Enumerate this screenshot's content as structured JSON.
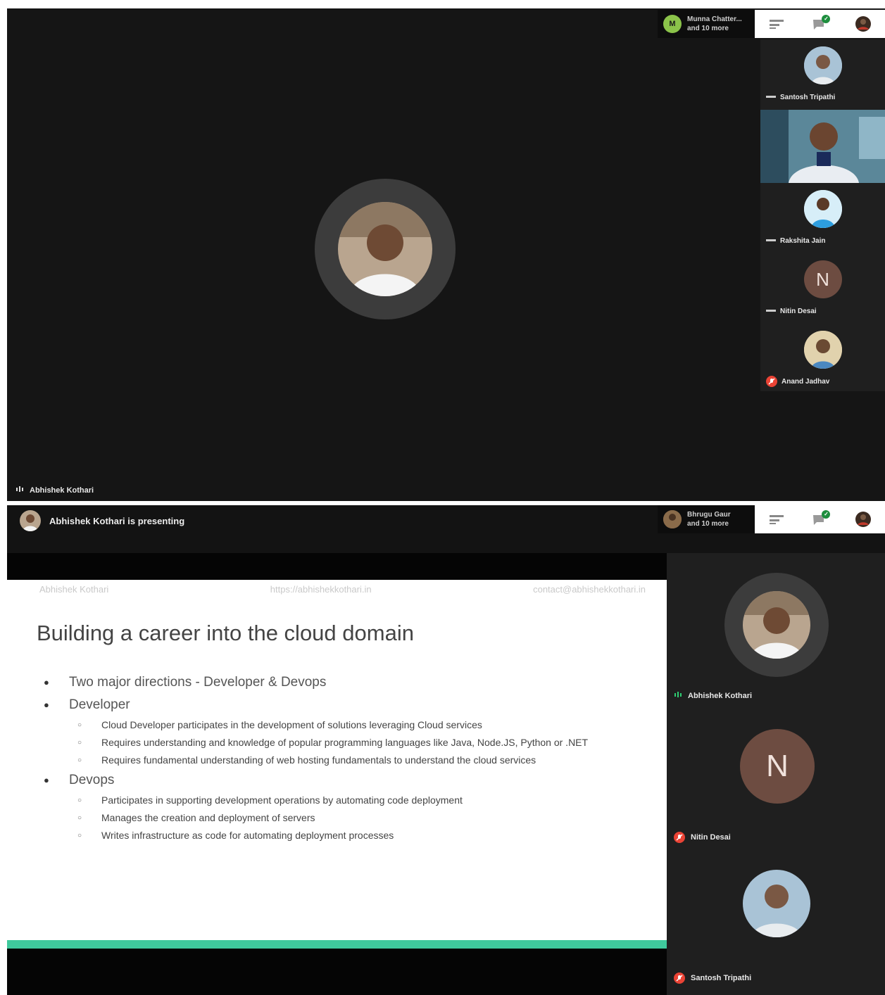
{
  "colors": {
    "meeting_bg": "#151515",
    "tile_bg": "#1f1f1f",
    "mic_off": "#ea4335",
    "slide_accent": "#3fc99c"
  },
  "top": {
    "participant_stack": {
      "initial": "M",
      "line1": "Munna Chatter...",
      "line2": "and 10 more"
    },
    "sidebar_tiles": [
      {
        "name": "Santosh Tripathi",
        "mic": "on"
      },
      {
        "name": "",
        "mic": "video"
      },
      {
        "name": "Rakshita Jain",
        "mic": "on"
      },
      {
        "name": "Nitin Desai",
        "initial": "N",
        "mic": "on"
      },
      {
        "name": "Anand Jadhav",
        "mic": "off"
      }
    ],
    "speaker_name": "Abhishek Kothari"
  },
  "bottom": {
    "presenting_text": "Abhishek Kothari is presenting",
    "participant_stack": {
      "line1": "Bhrugu Gaur",
      "line2": "and 10 more"
    },
    "slide": {
      "header_left": "Abhishek Kothari",
      "header_center": "https://abhishekkothari.in",
      "header_right": "contact@abhishekkothari.in",
      "title": "Building a career into the cloud domain",
      "bullets": [
        {
          "text": "Two major directions - Developer & Devops",
          "subs": []
        },
        {
          "text": "Developer",
          "subs": [
            "Cloud Developer participates in the development of solutions leveraging Cloud services",
            "Requires understanding and knowledge of popular programming languages like Java, Node.JS, Python or .NET",
            "Requires fundamental understanding of web hosting fundamentals to understand the cloud services"
          ]
        },
        {
          "text": "Devops",
          "subs": [
            "Participates in supporting development operations by automating code deployment",
            "Manages the creation and deployment of servers",
            "Writes infrastructure as code for automating deployment processes"
          ]
        }
      ]
    },
    "sidebar_tiles": [
      {
        "name": "Abhishek Kothari",
        "mic": "on"
      },
      {
        "name": "Nitin Desai",
        "initial": "N",
        "mic": "off"
      },
      {
        "name": "Santosh Tripathi",
        "mic": "off"
      }
    ]
  }
}
